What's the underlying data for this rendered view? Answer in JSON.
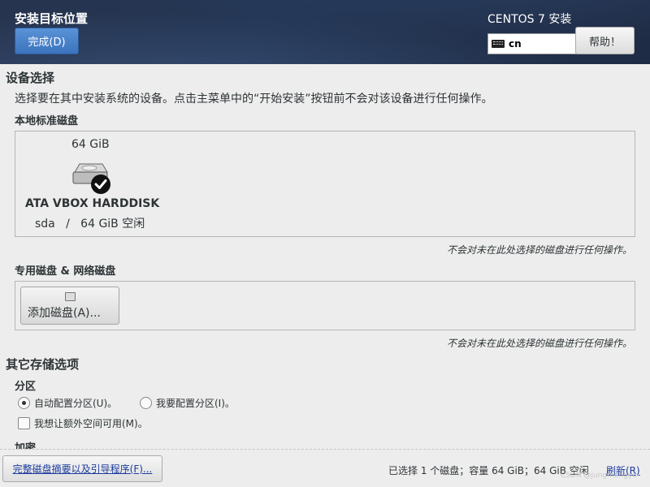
{
  "header": {
    "title": "安装目标位置",
    "done_label": "完成(D)",
    "product": "CENTOS 7 安装",
    "keyboard_layout": "cn",
    "help_label": "帮助！"
  },
  "device_selection": {
    "title": "设备选择",
    "description": "选择要在其中安装系统的设备。点击主菜单中的“开始安装”按钮前不会对该设备进行任何操作。",
    "local_disks_heading": "本地标准磁盘",
    "disk": {
      "size": "64 GiB",
      "name": "ATA VBOX HARDDISK",
      "details": "sda   /   64 GiB 空闲",
      "selected": true
    },
    "local_note": "不会对未在此处选择的磁盘进行任何操作。",
    "specialized_heading": "专用磁盘 & 网络磁盘",
    "add_disk_label": "添加磁盘(A)...",
    "specialized_note": "不会对未在此处选择的磁盘进行任何操作。"
  },
  "other_storage": {
    "title": "其它存储选项",
    "partition_heading": "分区",
    "auto_partition_label": "自动配置分区(U)。",
    "manual_partition_label": "我要配置分区(I)。",
    "extra_space_label": "我想让额外空间可用(M)。",
    "encryption_heading": "加密"
  },
  "footer": {
    "summary_label": "完整磁盘摘要以及引导程序(F)...",
    "status": "已选择 1 个磁盘；容量 64 GiB；64 GiB 空闲",
    "refresh_label": "刷新(R)",
    "watermark": "CSDN @jungmengyu"
  },
  "colors": {
    "header_bg": "#243654",
    "primary_button": "#3b74bd",
    "link": "#1c3c9e"
  }
}
